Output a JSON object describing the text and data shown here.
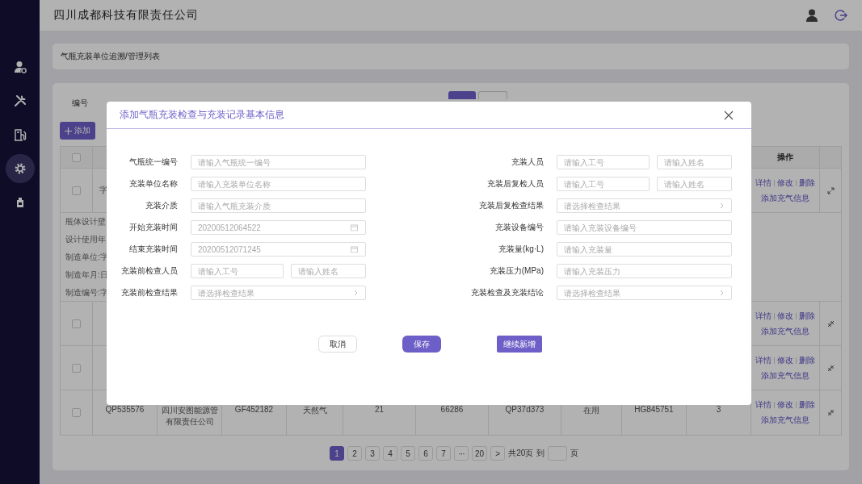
{
  "header": {
    "title": "四川成都科技有限责任公司"
  },
  "sidebar": {
    "items": [
      {
        "selected": false
      },
      {
        "selected": false
      },
      {
        "selected": false
      },
      {
        "selected": true
      },
      {
        "selected": false
      }
    ]
  },
  "breadcrumb": "气瓶充装单位追溯/管理列表",
  "filters": [
    {
      "label": "编号"
    }
  ],
  "add_button": {
    "label": "添加"
  },
  "table": {
    "header_checked": false,
    "columns": [
      {
        "label": "操作"
      }
    ],
    "rows": [
      {
        "checked": false,
        "expanded": true,
        "cells": [
          "字"
        ],
        "actions": [
          "详情",
          "修改",
          "删除"
        ],
        "extra_action": "添加充气信息",
        "details": [
          "瓶体设计壁",
          "设计使用年",
          "制造单位:字",
          "制造年月:日",
          "制造编号:字"
        ]
      },
      {
        "checked": false,
        "expanded": false,
        "actions": [
          "详情",
          "修改",
          "删除"
        ],
        "extra_action": "添加充气信息"
      },
      {
        "checked": false,
        "expanded": false,
        "actions": [
          "详情",
          "修改",
          "删除"
        ],
        "extra_action": "添加充气信息"
      },
      {
        "checked": false,
        "expanded": false,
        "cells": [
          "QP535576",
          "四川安图能源管有限责任公司",
          "GF452182",
          "天然气",
          "21",
          "66286",
          "QP37d373",
          "在用",
          "HG845751",
          "3"
        ],
        "actions": [
          "详情",
          "修改",
          "删除"
        ],
        "extra_action": "添加充气信息"
      }
    ]
  },
  "pagination": {
    "items": [
      {
        "kind": "page",
        "label": "1",
        "selected": true
      },
      {
        "kind": "page",
        "label": "2",
        "selected": false
      },
      {
        "kind": "page",
        "label": "3",
        "selected": false
      },
      {
        "kind": "page",
        "label": "4",
        "selected": false
      },
      {
        "kind": "page",
        "label": "5",
        "selected": false
      },
      {
        "kind": "page",
        "label": "6",
        "selected": false
      },
      {
        "kind": "page",
        "label": "7",
        "selected": false
      },
      {
        "kind": "ellipsis",
        "label": "···",
        "selected": false
      },
      {
        "kind": "page",
        "label": "20",
        "selected": false
      },
      {
        "kind": "next",
        "label": ">",
        "selected": false
      }
    ],
    "total": "共20页",
    "goto": "到",
    "unit": "页"
  },
  "dialog": {
    "title": "添加气瓶充装检查与充装记录基本信息",
    "left_fields": [
      {
        "label": "气瓶统一编号",
        "kind": "text",
        "placeholder": "请输入气瓶统一编号"
      },
      {
        "label": "充装单位名称",
        "kind": "text",
        "placeholder": "请输入充装单位名称"
      },
      {
        "label": "充装介质",
        "kind": "text",
        "placeholder": "请输入气瓶充装介质"
      },
      {
        "label": "开始充装时间",
        "kind": "date",
        "placeholder": "20200512064522"
      },
      {
        "label": "结束充装时间",
        "kind": "date",
        "placeholder": "20200512071245"
      },
      {
        "label": "充装前检查人员",
        "kind": "pair",
        "placeholders": [
          "请输入工号",
          "请输入姓名"
        ]
      },
      {
        "label": "充装前检查结果",
        "kind": "select",
        "placeholder": "请选择检查结果"
      }
    ],
    "right_fields": [
      {
        "label": "充装人员",
        "kind": "pair",
        "placeholders": [
          "请输入工号",
          "请输入姓名"
        ]
      },
      {
        "label": "充装后复检人员",
        "kind": "pair",
        "placeholders": [
          "请输入工号",
          "请输入姓名"
        ]
      },
      {
        "label": "充装后复检查结果",
        "kind": "select",
        "placeholder": "请选择检查结果"
      },
      {
        "label": "充装设备编号",
        "kind": "text",
        "placeholder": "请输入充装设备编号"
      },
      {
        "label": "充装量(kg·L)",
        "kind": "text",
        "placeholder": "请输入充装量"
      },
      {
        "label": "充装压力(MPa)",
        "kind": "text",
        "placeholder": "请输入充装压力"
      },
      {
        "label": "充装检查及充装结论",
        "kind": "select",
        "placeholder": "请选择检查结果"
      }
    ],
    "buttons": [
      {
        "label": "取消",
        "kind": "default"
      },
      {
        "label": "保存",
        "kind": "primary"
      },
      {
        "label": "继续新增",
        "kind": "square"
      }
    ]
  }
}
